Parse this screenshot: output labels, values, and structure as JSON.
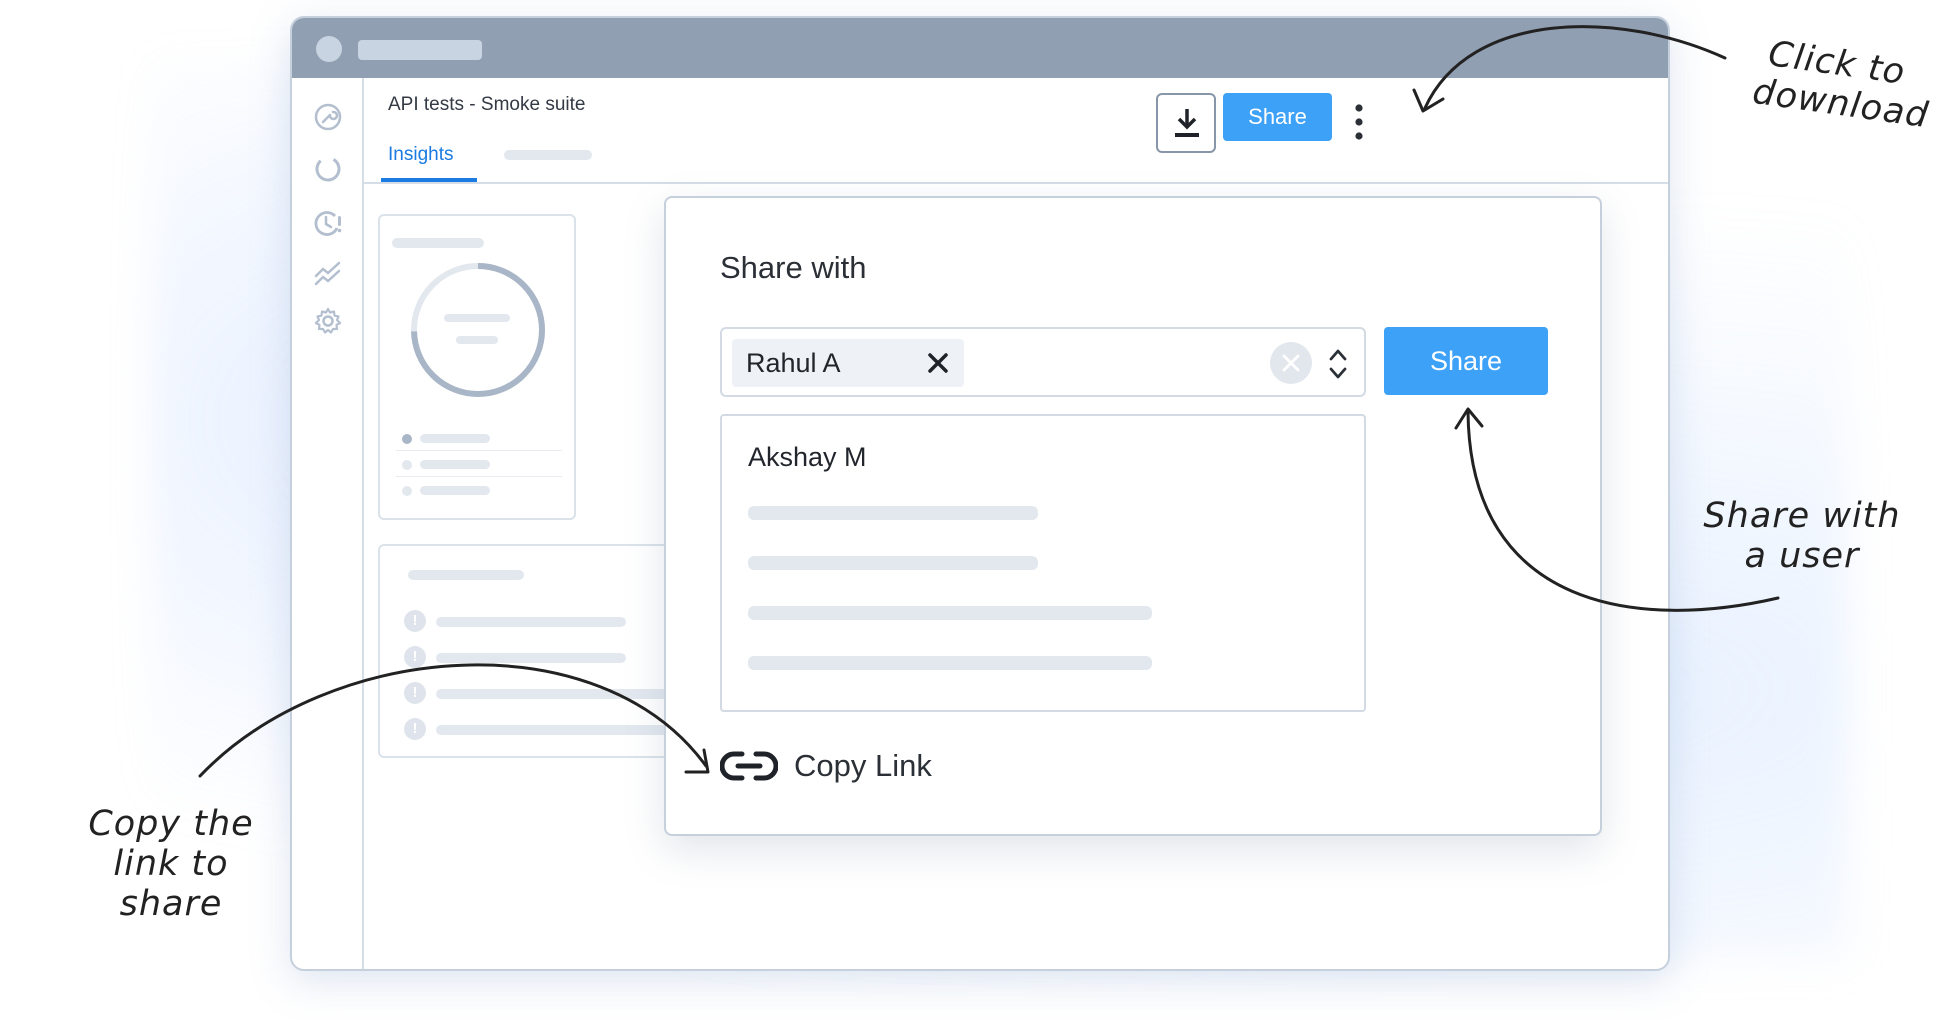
{
  "page": {
    "title": "API tests - Smoke suite",
    "tabs": [
      {
        "label": "Insights",
        "active": true
      }
    ]
  },
  "toolbar": {
    "download_icon": "download-icon",
    "share_label": "Share",
    "more_icon": "kebab-menu-icon"
  },
  "sidebar": {
    "items": [
      {
        "icon": "tools-icon"
      },
      {
        "icon": "progress-ring-icon"
      },
      {
        "icon": "alert-clock-icon"
      },
      {
        "icon": "trend-lines-icon"
      },
      {
        "icon": "gear-icon"
      }
    ]
  },
  "share_dialog": {
    "title": "Share with",
    "selected_user": "Rahul A",
    "share_label": "Share",
    "options": [
      "Akshay M"
    ],
    "copy_link_label": "Copy Link"
  },
  "annotations": {
    "download": [
      "Click to",
      "download"
    ],
    "share_user": [
      "Share with",
      "a user"
    ],
    "copy_link": [
      "Copy the",
      "link to share"
    ]
  },
  "colors": {
    "accent": "#3da1f7",
    "tab_active": "#1c7be0",
    "titlebar": "#919fb2"
  }
}
